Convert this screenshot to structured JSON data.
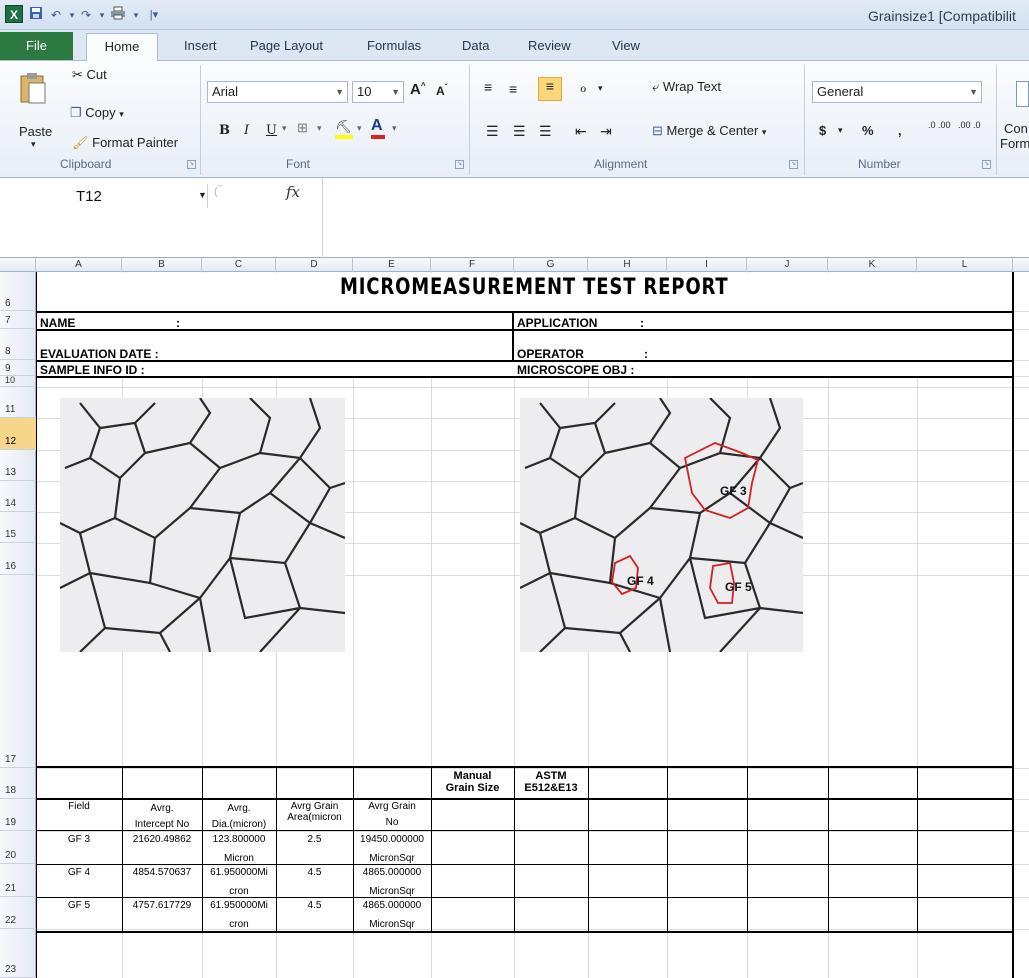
{
  "window": {
    "title": "Grainsize1  [Compatibilit"
  },
  "tabs": [
    "File",
    "Home",
    "Insert",
    "Page Layout",
    "Formulas",
    "Data",
    "Review",
    "View"
  ],
  "ribbon": {
    "clipboard": {
      "paste": "Paste",
      "cut": "Cut",
      "copy": "Copy",
      "format_painter": "Format Painter",
      "label": "Clipboard"
    },
    "font": {
      "name": "Arial",
      "size": "10",
      "label": "Font",
      "bold": "B",
      "italic": "I",
      "underline": "U"
    },
    "alignment": {
      "wrap": "Wrap Text",
      "merge": "Merge & Center",
      "label": "Alignment"
    },
    "number": {
      "format": "General",
      "label": "Number",
      "currency": "$",
      "percent": "%",
      "comma": ",",
      "inc": ".0 .00",
      "dec": ".00 .0"
    },
    "styles": {
      "cond": "Con",
      "form": "Form"
    }
  },
  "namebox": "T12",
  "fx": "fx",
  "columns": [
    "A",
    "B",
    "C",
    "D",
    "E",
    "F",
    "G",
    "H",
    "I",
    "J",
    "K",
    "L"
  ],
  "rows": [
    "6",
    "7",
    "8",
    "9",
    "10",
    "11",
    "12",
    "13",
    "14",
    "15",
    "16",
    "17",
    "18",
    "19",
    "20",
    "21",
    "22",
    "23"
  ],
  "report": {
    "title": "MICROMEASUREMENT  TEST  REPORT",
    "name": "NAME",
    "colon": ":",
    "eval": "EVALUATION DATE  :",
    "sample": "SAMPLE INFO ID      :",
    "application": "APPLICATION",
    "operator": "OPERATOR",
    "microscope": "MICROSCOPE OBJ :"
  },
  "image_labels": [
    "GF 3",
    "GF 4",
    "GF 5"
  ],
  "table": {
    "header_manual": [
      "Manual",
      "Grain Size"
    ],
    "header_astm": [
      "ASTM",
      "E512&E13"
    ],
    "col_headers": [
      [
        "Field",
        ""
      ],
      [
        "Avrg.",
        "Intercept No"
      ],
      [
        "Avrg.",
        "Dia.(micron)"
      ],
      [
        "Avrg Grain",
        "Area(micron"
      ],
      [
        "Avrg Grain",
        "No"
      ]
    ],
    "rows": [
      {
        "field": "GF 3",
        "intercept": "21620.49862",
        "dia": [
          "123.800000",
          "Micron"
        ],
        "area": "2.5",
        "no": [
          "19450.000000",
          "MicronSqr"
        ]
      },
      {
        "field": "GF 4",
        "intercept": "4854.570637",
        "dia": [
          "61.950000Mi",
          "cron"
        ],
        "area": "4.5",
        "no": [
          "4865.000000",
          "MicronSqr"
        ]
      },
      {
        "field": "GF 5",
        "intercept": "4757.617729",
        "dia": [
          "61.950000Mi",
          "cron"
        ],
        "area": "4.5",
        "no": [
          "4865.000000",
          "MicronSqr"
        ]
      }
    ]
  }
}
